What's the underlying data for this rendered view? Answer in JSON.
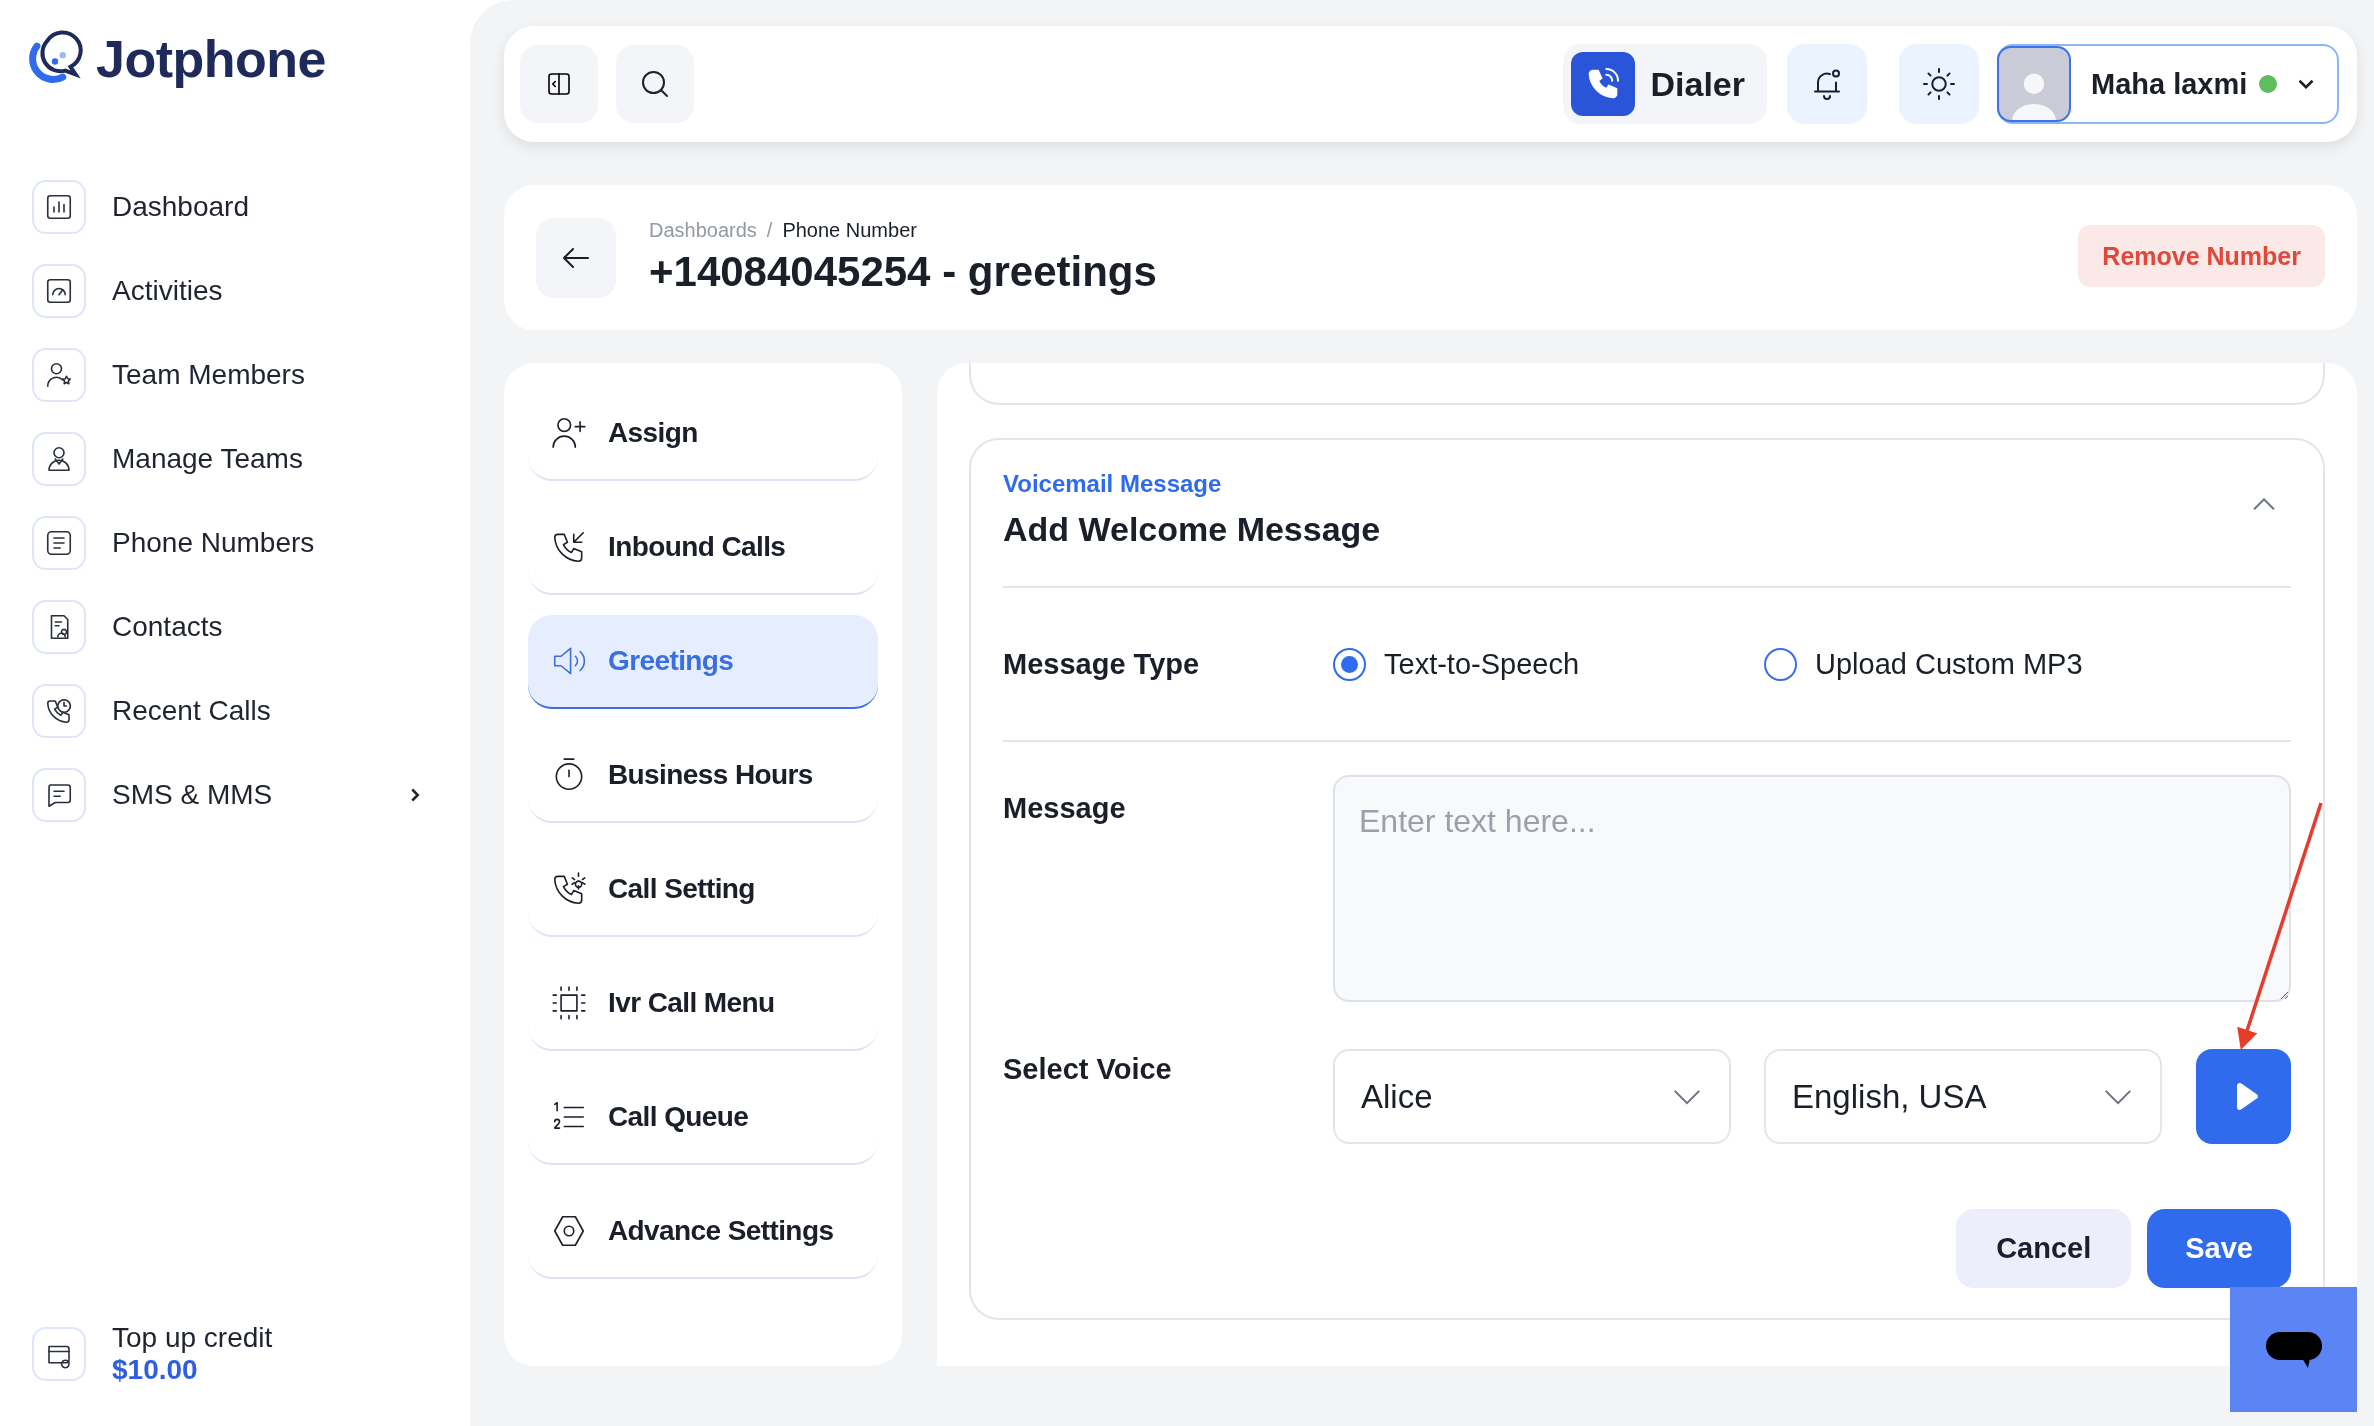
{
  "brand": {
    "name": "Jotphone"
  },
  "sidebar": {
    "items": [
      {
        "label": "Dashboard",
        "kind": "dashboard",
        "expandable": false
      },
      {
        "label": "Activities",
        "kind": "activities",
        "expandable": false
      },
      {
        "label": "Team Members",
        "kind": "member",
        "expandable": false
      },
      {
        "label": "Manage Teams",
        "kind": "teams",
        "expandable": false
      },
      {
        "label": "Phone Numbers",
        "kind": "numbers",
        "expandable": false
      },
      {
        "label": "Contacts",
        "kind": "contacts",
        "expandable": false
      },
      {
        "label": "Recent Calls",
        "kind": "recent",
        "expandable": false
      },
      {
        "label": "SMS & MMS",
        "kind": "sms",
        "expandable": true
      }
    ],
    "credit": {
      "label": "Top up credit",
      "amount": "$10.00"
    }
  },
  "topbar": {
    "dialer": "Dialer",
    "user": {
      "name": "Maha laxmi",
      "online": true
    }
  },
  "header": {
    "breadcrumb": [
      "Dashboards",
      "Phone Number"
    ],
    "separator": "/",
    "title": "+14084045254 - greetings",
    "action": "Remove Number"
  },
  "menu": [
    {
      "label": "Assign",
      "kind": "assign",
      "selected": false
    },
    {
      "label": "Inbound Calls",
      "kind": "inbound",
      "selected": false
    },
    {
      "label": "Greetings",
      "kind": "greetings",
      "selected": true
    },
    {
      "label": "Business Hours",
      "kind": "hours",
      "selected": false
    },
    {
      "label": "Call Setting",
      "kind": "setting",
      "selected": false
    },
    {
      "label": "Ivr Call Menu",
      "kind": "ivr",
      "selected": false
    },
    {
      "label": "Call Queue",
      "kind": "queue",
      "selected": false
    },
    {
      "label": "Advance Settings",
      "kind": "advanced",
      "selected": false
    }
  ],
  "voicemail": {
    "eyebrow": "Voicemail Message",
    "title": "Add Welcome Message",
    "expanded": true,
    "message_type": {
      "label": "Message Type",
      "options": [
        {
          "label": "Text-to-Speech",
          "selected": true
        },
        {
          "label": "Upload Custom MP3",
          "selected": false
        }
      ]
    },
    "message": {
      "label": "Message",
      "placeholder": "Enter text here..."
    },
    "voice": {
      "label": "Select Voice",
      "voice": "Alice",
      "language": "English, USA"
    },
    "buttons": {
      "cancel": "Cancel",
      "save": "Save"
    }
  }
}
